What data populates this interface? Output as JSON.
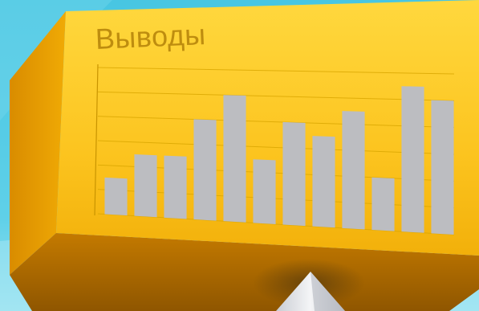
{
  "title": "Выводы",
  "colors": {
    "background_top": "#4fcbe4",
    "background_bottom": "#8ee0ef",
    "box_front_top": "#ffd23a",
    "box_front_bottom": "#f3b40a",
    "box_side": "#e8a000",
    "box_bottom": "#b77000",
    "bar": "#bcbdc1",
    "grid": "#d9a600",
    "pointer": "#e4e6ea"
  },
  "chart_data": {
    "type": "bar",
    "title": "Выводы",
    "categories": [
      "",
      "",
      "",
      "",
      "",
      "",
      "",
      "",
      "",
      "",
      "",
      ""
    ],
    "values": [
      3,
      5,
      5,
      8,
      10,
      5,
      8,
      7,
      9,
      4,
      11,
      10
    ],
    "xlabel": "",
    "ylabel": "",
    "ylim": [
      0,
      12
    ],
    "grid": true,
    "legend": "none"
  }
}
